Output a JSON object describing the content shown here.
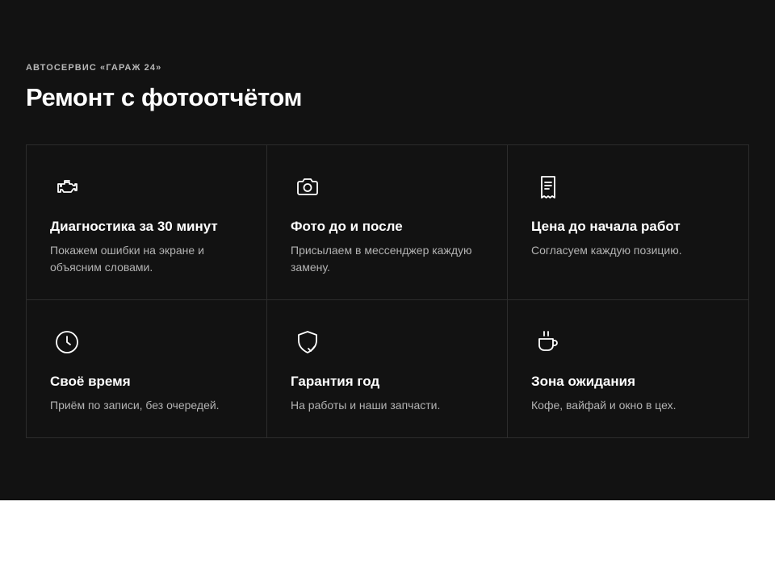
{
  "header": {
    "eyebrow": "АВТОСЕРВИС «ГАРАЖ 24»",
    "title": "Ремонт с фотоотчётом"
  },
  "features": [
    {
      "icon": "engine-icon",
      "title": "Диагностика за 30 минут",
      "text": "Покажем ошибки на экране и объясним словами."
    },
    {
      "icon": "camera-icon",
      "title": "Фото до и после",
      "text": "Присылаем в мессенджер каждую замену."
    },
    {
      "icon": "receipt-icon",
      "title": "Цена до начала работ",
      "text": "Согласуем каждую позицию."
    },
    {
      "icon": "clock-icon",
      "title": "Своё время",
      "text": "Приём по записи, без очередей."
    },
    {
      "icon": "shield-check-icon",
      "title": "Гарантия год",
      "text": "На работы и наши запчасти."
    },
    {
      "icon": "coffee-cup-icon",
      "title": "Зона ожидания",
      "text": "Кофе, вайфай и окно в цех."
    }
  ],
  "colors": {
    "background": "#121212",
    "border": "#2c2c2c",
    "title": "#ffffff",
    "muted": "#b3b3b3"
  }
}
